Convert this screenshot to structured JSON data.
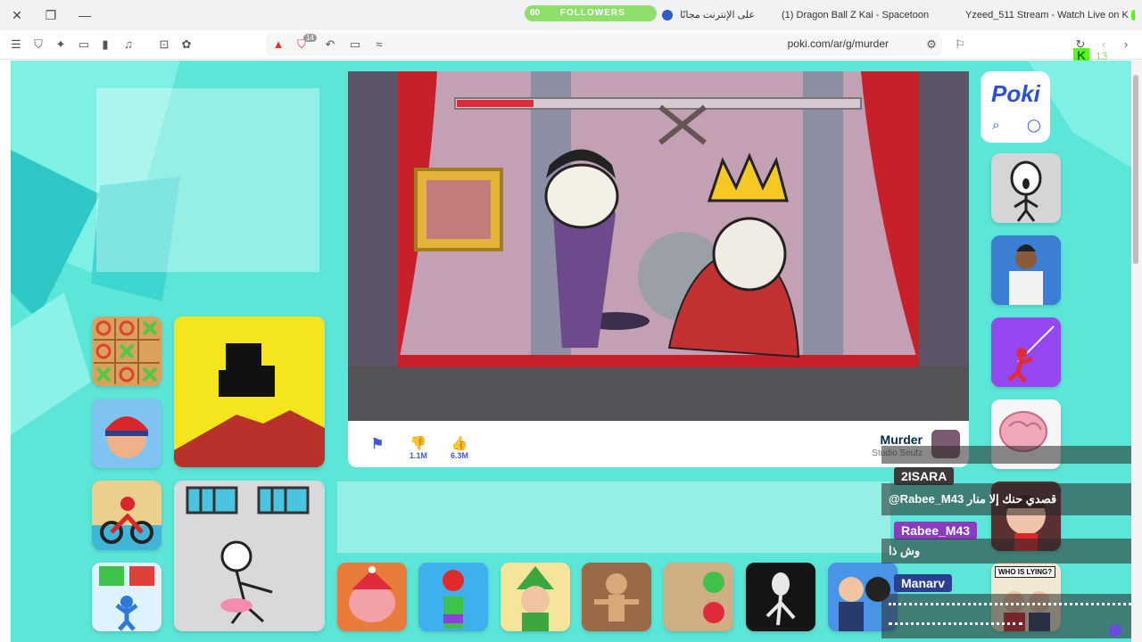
{
  "browser": {
    "tabs": [
      {
        "label": "على الإنترنت مجانًا",
        "icon": "poki-tab-icon"
      },
      {
        "label": "(1) Dragon Ball Z Kai - Spacetoon",
        "icon": "youtube-icon"
      },
      {
        "label": "Yzeed_511 Stream - Watch Live on K",
        "icon": "kick-icon"
      }
    ],
    "url": "poki.com/ar/g/murder",
    "extension_badge": "14",
    "followers_overlay": {
      "count": "60",
      "label": "FOLLOWERS"
    },
    "kick_badge": "13"
  },
  "game": {
    "title": "Murder",
    "developer": "Studio Seufz",
    "dislikes": "1.1M",
    "likes": "6.3M"
  },
  "sidebar_games": [
    "poki-logo-card",
    "stickman-game",
    "bearded-man-game",
    "spider-stickman-game",
    "brain-test-game",
    "scary-teacher-game"
  ],
  "left_games": [
    "tic-tac-toe",
    "monkey-mart-like-yellow",
    "subway-surfers",
    "moto-x3m",
    "stickman-prison",
    "crowd-run"
  ],
  "bottom_games": [
    "pig-game",
    "apple-worm",
    "forest-elf",
    "voodoo-doll",
    "thumbs-game",
    "slenderman",
    "ninja-agent",
    "card-game",
    "who-is-lying"
  ],
  "who_is_lying_label": "WHO IS LYING?",
  "chat": [
    {
      "user": "2ISARA",
      "message": "@Rabee_M43 قصدي حنك إلا منار",
      "user_color": "#3a3a3a"
    },
    {
      "user": "Rabee_M43",
      "message": "وش ذا",
      "user_color": "#8a3cbf"
    },
    {
      "user": "Manarv",
      "message": "",
      "user_color": "#2a3f8f"
    }
  ],
  "colors": {
    "page_bg": "#5ce6d8",
    "accent": "#3f5bd8"
  }
}
